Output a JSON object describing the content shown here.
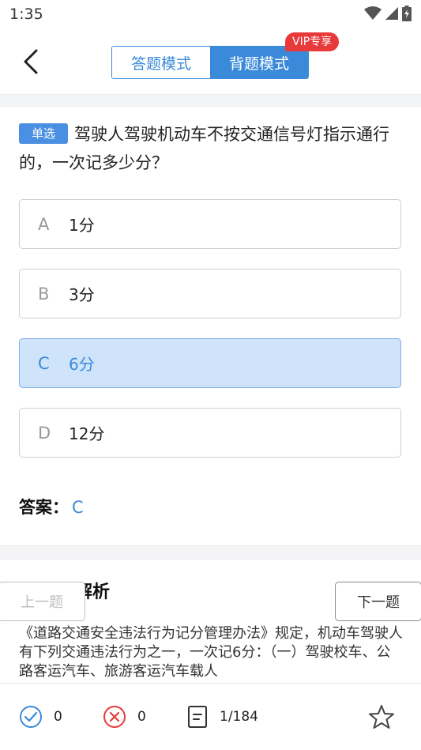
{
  "status_bar": {
    "time": "1:35"
  },
  "header": {
    "mode_tabs": [
      {
        "label": "答题模式"
      },
      {
        "label": "背题模式"
      }
    ],
    "vip_badge": "VIP专享"
  },
  "question": {
    "type_label": "单选",
    "text": "驾驶人驾驶机动车不按交通信号灯指示通行的，一次记多少分？",
    "options": [
      {
        "letter": "A",
        "text": "1分"
      },
      {
        "letter": "B",
        "text": "3分"
      },
      {
        "letter": "C",
        "text": "6分"
      },
      {
        "letter": "D",
        "text": "12分"
      }
    ],
    "selected": "C"
  },
  "answer": {
    "label": "答案：",
    "value": "C"
  },
  "analysis": {
    "title": "解析",
    "text": "《道路交通安全违法行为记分管理办法》规定，机动车驾驶人有下列交通违法行为之一，一次记6分：（一）驾驶校车、公路客运汽车、旅游客运汽车载人"
  },
  "navigation": {
    "prev_label": "上一题",
    "next_label": "下一题"
  },
  "bottom_bar": {
    "correct_count": "0",
    "wrong_count": "0",
    "progress": "1/184"
  },
  "colors": {
    "accent": "#3b8ad9",
    "vip": "#e8393b",
    "wrong": "#e8393b",
    "selected_bg": "#cfe3fb"
  }
}
